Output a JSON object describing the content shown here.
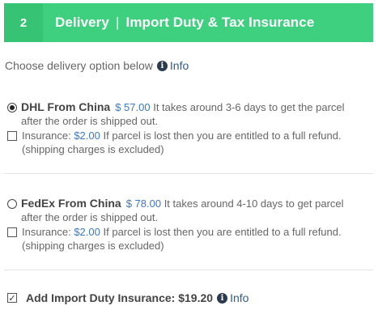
{
  "header": {
    "step": "2",
    "title_left": "Delivery",
    "separator": "|",
    "title_right": "Import Duty & Tax Insurance"
  },
  "prompt": {
    "text": "Choose delivery option below",
    "info_label": "Info"
  },
  "options": [
    {
      "name": "DHL From China",
      "price": "$ 57.00",
      "desc_1": "It takes around 3-6 days to get the parcel",
      "desc_2": "after the order is shipped out.",
      "selected": true,
      "insurance_label": "Insurance:",
      "insurance_price": "$2.00",
      "insurance_text": "If parcel is lost then you are entitled to a full refund.",
      "insurance_note": "(shipping charges is excluded)",
      "insurance_checked": false
    },
    {
      "name": "FedEx From China",
      "price": "$ 78.00",
      "desc_1": "It takes around 4-10 days to get parcel",
      "desc_2": "after the order is shipped out.",
      "selected": false,
      "insurance_label": "Insurance:",
      "insurance_price": "$2.00",
      "insurance_text": "If parcel is lost then you are entitled to a full refund.",
      "insurance_note": "(shipping charges is excluded)",
      "insurance_checked": false
    }
  ],
  "duty": {
    "label": "Add Import Duty Insurance: $19.20",
    "info_label": "Info",
    "checked": true
  },
  "colors": {
    "header_bg": "#3fd07f",
    "step_bg": "#36c374",
    "price": "#3c78c8",
    "link": "#2a5c9a"
  },
  "icons": {
    "info": "info-circle-icon",
    "check": "checkmark-icon"
  }
}
